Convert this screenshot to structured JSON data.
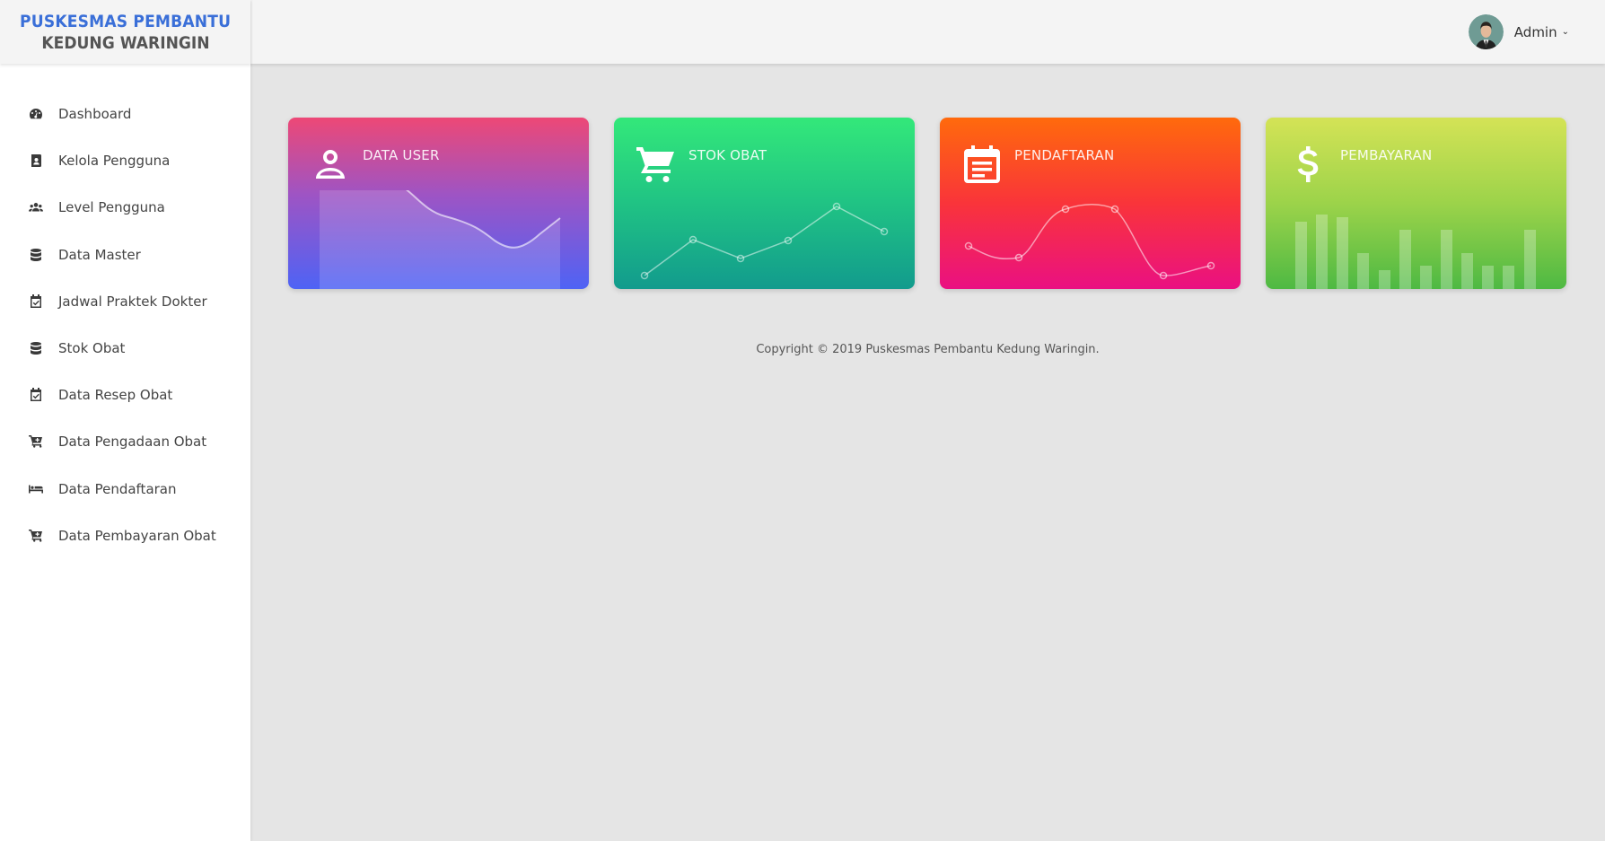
{
  "brand": {
    "line1": "PUSKESMAS PEMBANTU",
    "line2": "KEDUNG WARINGIN"
  },
  "sidebar": {
    "items": [
      {
        "label": "Dashboard",
        "icon": "dashboard-icon"
      },
      {
        "label": "Kelola Pengguna",
        "icon": "user-book-icon"
      },
      {
        "label": "Level Pengguna",
        "icon": "users-icon"
      },
      {
        "label": "Data Master",
        "icon": "database-icon"
      },
      {
        "label": "Jadwal Praktek Dokter",
        "icon": "calendar-check-icon"
      },
      {
        "label": "Stok Obat",
        "icon": "database-icon"
      },
      {
        "label": "Data Resep Obat",
        "icon": "calendar-check-icon"
      },
      {
        "label": "Data Pengadaan Obat",
        "icon": "cart-icon"
      },
      {
        "label": "Data Pendaftaran",
        "icon": "bed-icon"
      },
      {
        "label": "Data Pembayaran Obat",
        "icon": "cart-icon"
      }
    ]
  },
  "topbar": {
    "user_name": "Admin",
    "chevron": "⌄"
  },
  "cards": [
    {
      "title": "DATA USER",
      "icon": "user-icon",
      "chart": "area"
    },
    {
      "title": "STOK OBAT",
      "icon": "cart-icon",
      "chart": "line"
    },
    {
      "title": "PENDAFTARAN",
      "icon": "calendar-icon",
      "chart": "spline"
    },
    {
      "title": "PEMBAYARAN",
      "icon": "dollar-icon",
      "chart": "bar"
    }
  ],
  "colors": {
    "brand_blue": "#3a6fd8",
    "card_purple": "#9e54c4",
    "card_green": "#20c384",
    "card_orange": "#f9343a",
    "card_lime": "#9cd34a"
  },
  "footer": {
    "text": "Copyright © 2019 Puskesmas Pembantu Kedung Waringin."
  }
}
